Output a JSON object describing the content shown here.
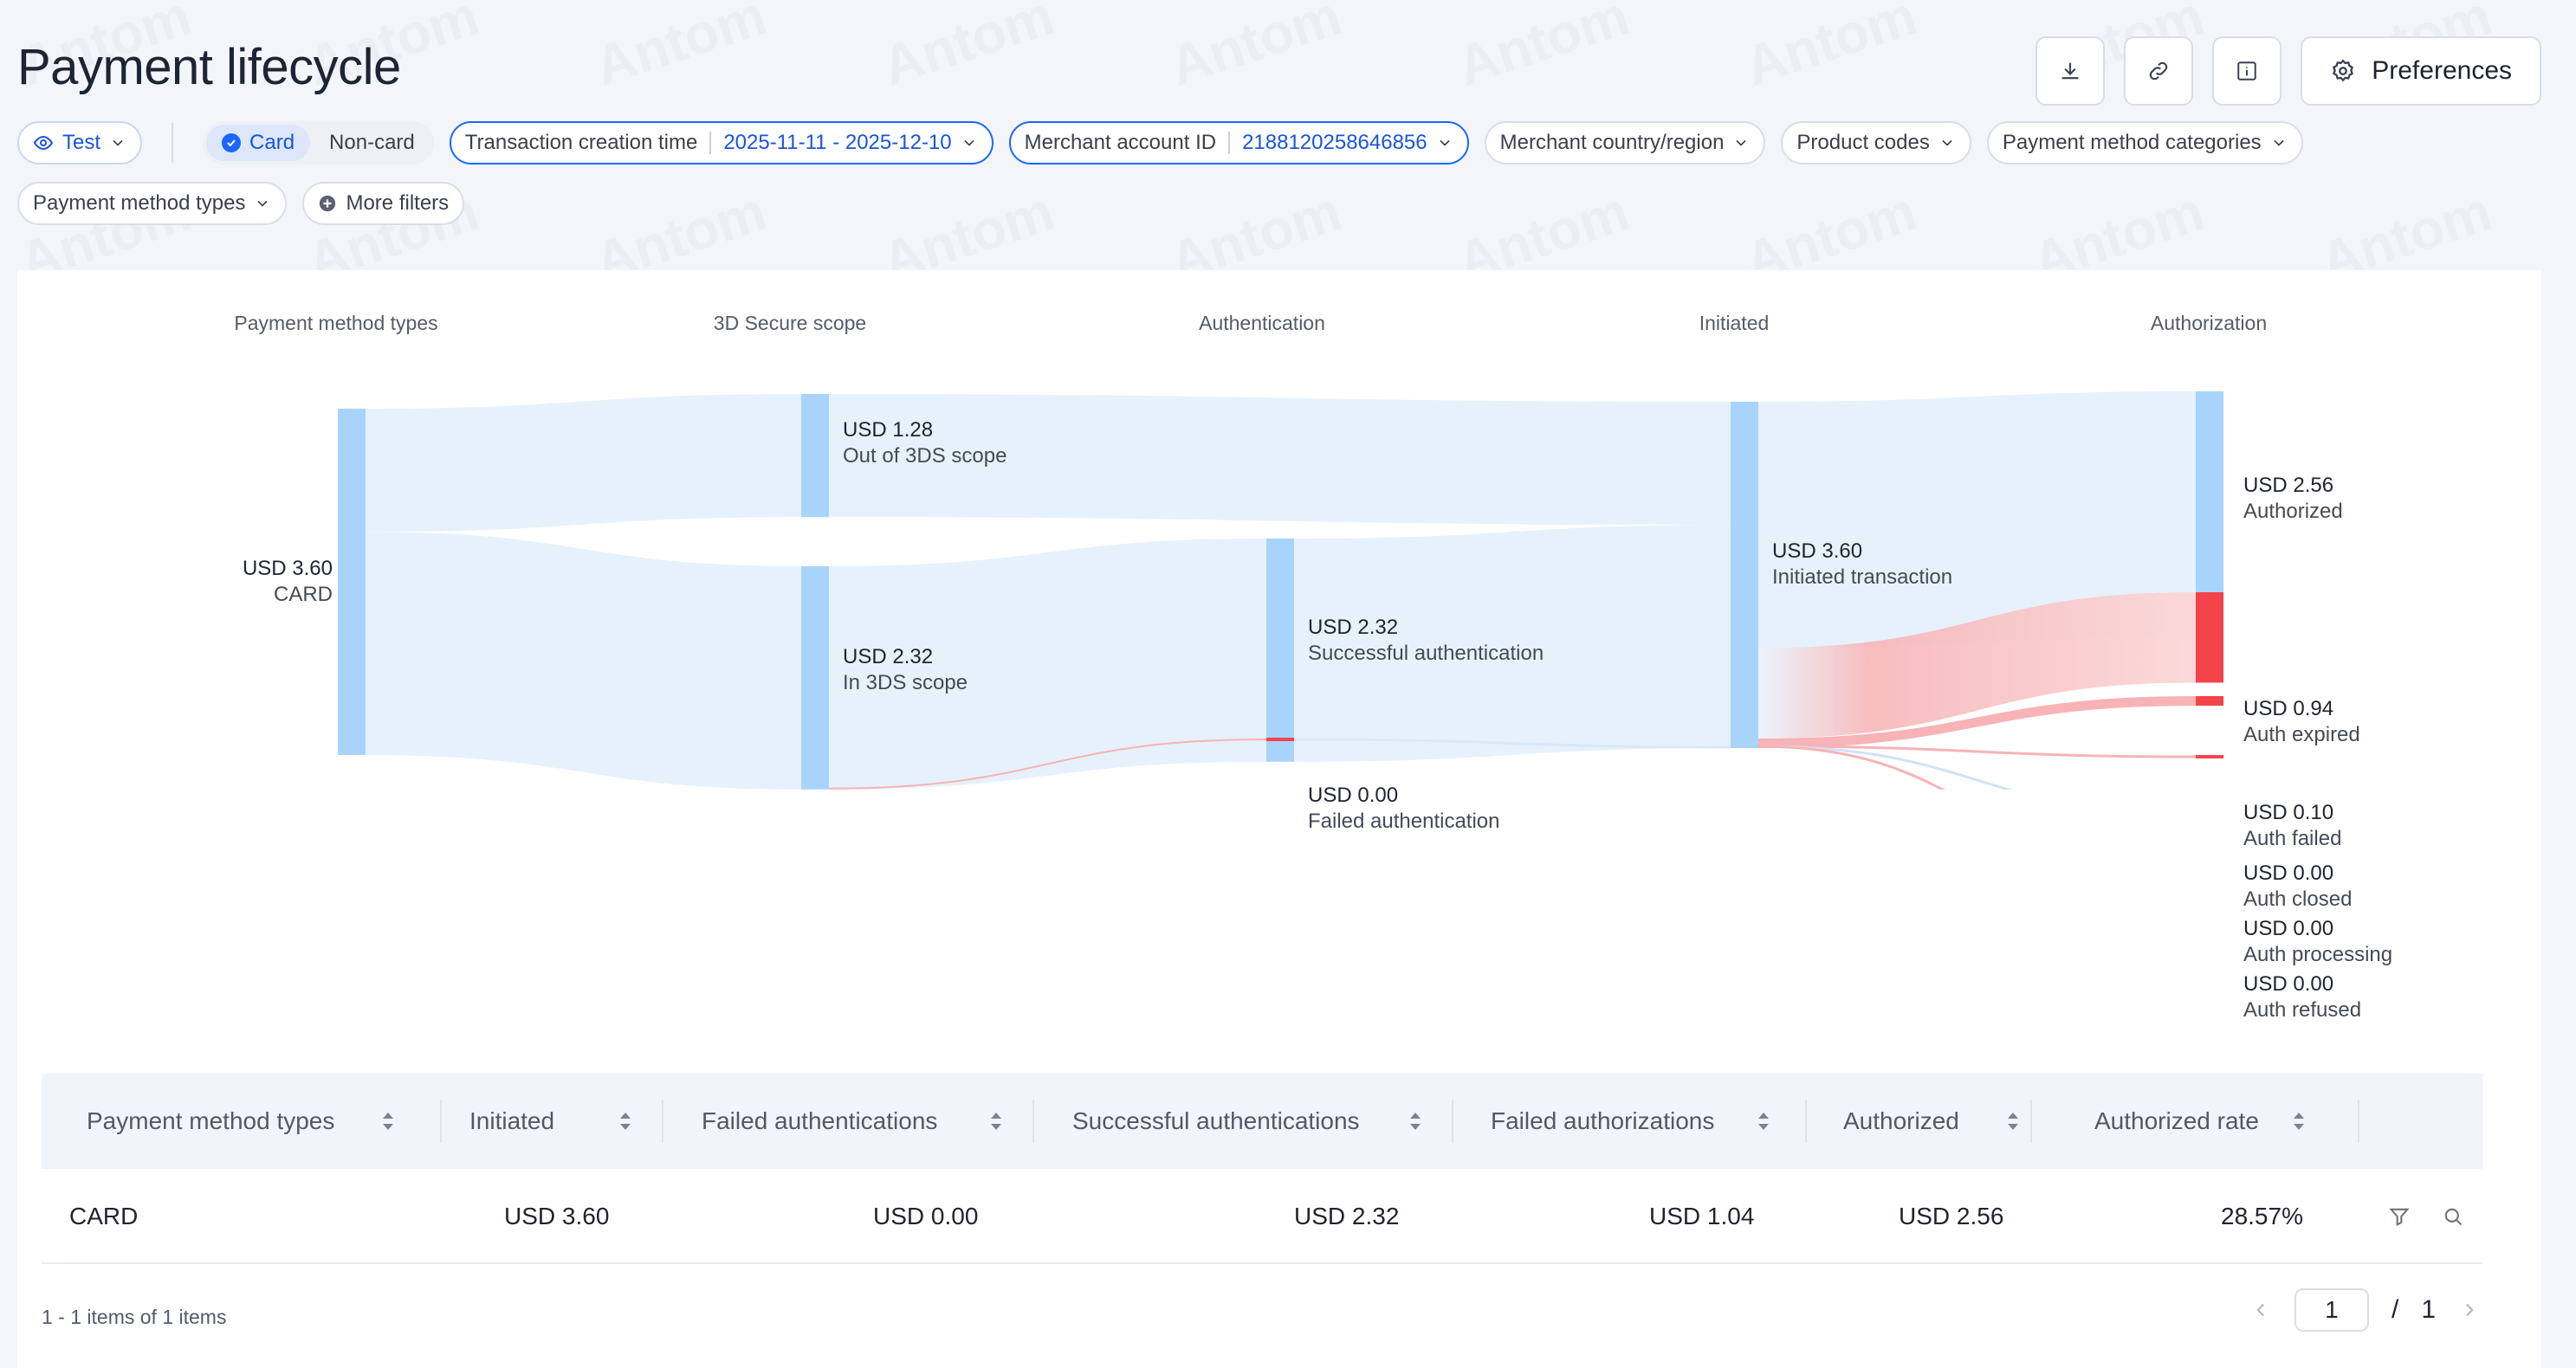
{
  "title": "Payment lifecycle",
  "actions": {
    "preferences": "Preferences"
  },
  "filters": {
    "env": "Test",
    "card": "Card",
    "noncard": "Non-card",
    "txn_time_label": "Transaction creation time",
    "txn_time_value": "2025-11-11 - 2025-12-10",
    "merchant_label": "Merchant account ID",
    "merchant_value": "2188120258646856",
    "country": "Merchant country/region",
    "product": "Product codes",
    "pm_categories": "Payment method categories",
    "pm_types": "Payment method types",
    "more": "More filters"
  },
  "columns": [
    "Payment method types",
    "3D Secure scope",
    "Authentication",
    "Initiated",
    "Authorization"
  ],
  "nodes": {
    "card": {
      "amount": "USD 3.60",
      "name": "CARD"
    },
    "out3ds": {
      "amount": "USD 1.28",
      "name": "Out of 3DS scope"
    },
    "in3ds": {
      "amount": "USD 2.32",
      "name": "In 3DS scope"
    },
    "succ_auth": {
      "amount": "USD 2.32",
      "name": "Successful authentication"
    },
    "fail_auth": {
      "amount": "USD 0.00",
      "name": "Failed authentication"
    },
    "initiated": {
      "amount": "USD 3.60",
      "name": "Initiated transaction"
    },
    "authorized": {
      "amount": "USD 2.56",
      "name": "Authorized"
    },
    "expired": {
      "amount": "USD 0.94",
      "name": "Auth expired"
    },
    "failed": {
      "amount": "USD 0.10",
      "name": "Auth failed"
    },
    "closed": {
      "amount": "USD 0.00",
      "name": "Auth closed"
    },
    "processing": {
      "amount": "USD 0.00",
      "name": "Auth processing"
    },
    "refused": {
      "amount": "USD 0.00",
      "name": "Auth refused"
    }
  },
  "chart_data": {
    "type": "sankey",
    "stages": [
      "Payment method types",
      "3D Secure scope",
      "Authentication",
      "Initiated",
      "Authorization"
    ],
    "links": [
      {
        "source": "CARD",
        "target": "Out of 3DS scope",
        "value": 1.28
      },
      {
        "source": "CARD",
        "target": "In 3DS scope",
        "value": 2.32
      },
      {
        "source": "In 3DS scope",
        "target": "Successful authentication",
        "value": 2.32
      },
      {
        "source": "In 3DS scope",
        "target": "Failed authentication",
        "value": 0.0
      },
      {
        "source": "Out of 3DS scope",
        "target": "Initiated transaction",
        "value": 1.28
      },
      {
        "source": "Successful authentication",
        "target": "Initiated transaction",
        "value": 2.32
      },
      {
        "source": "Failed authentication",
        "target": "Initiated transaction",
        "value": 0.0
      },
      {
        "source": "Initiated transaction",
        "target": "Authorized",
        "value": 2.56
      },
      {
        "source": "Initiated transaction",
        "target": "Auth expired",
        "value": 0.94
      },
      {
        "source": "Initiated transaction",
        "target": "Auth failed",
        "value": 0.1
      },
      {
        "source": "Initiated transaction",
        "target": "Auth closed",
        "value": 0.0
      },
      {
        "source": "Initiated transaction",
        "target": "Auth processing",
        "value": 0.0
      },
      {
        "source": "Initiated transaction",
        "target": "Auth refused",
        "value": 0.0
      }
    ],
    "colors": {
      "neutral_node": "#a8d4fb",
      "neutral_link": "#e6f1fc",
      "fail_node": "#f4434a",
      "fail_link": "#f7b3b6"
    }
  },
  "table": {
    "headers": [
      "Payment method types",
      "Initiated",
      "Failed authentications",
      "Successful authentications",
      "Failed authorizations",
      "Authorized",
      "Authorized rate"
    ],
    "row": [
      "CARD",
      "USD 3.60",
      "USD 0.00",
      "USD 2.32",
      "USD 1.04",
      "USD 2.56",
      "28.57%"
    ]
  },
  "pagination": {
    "summary": "1 - 1 items of 1 items",
    "current": "1",
    "sep": "/",
    "total": "1"
  },
  "watermark": "Antom"
}
